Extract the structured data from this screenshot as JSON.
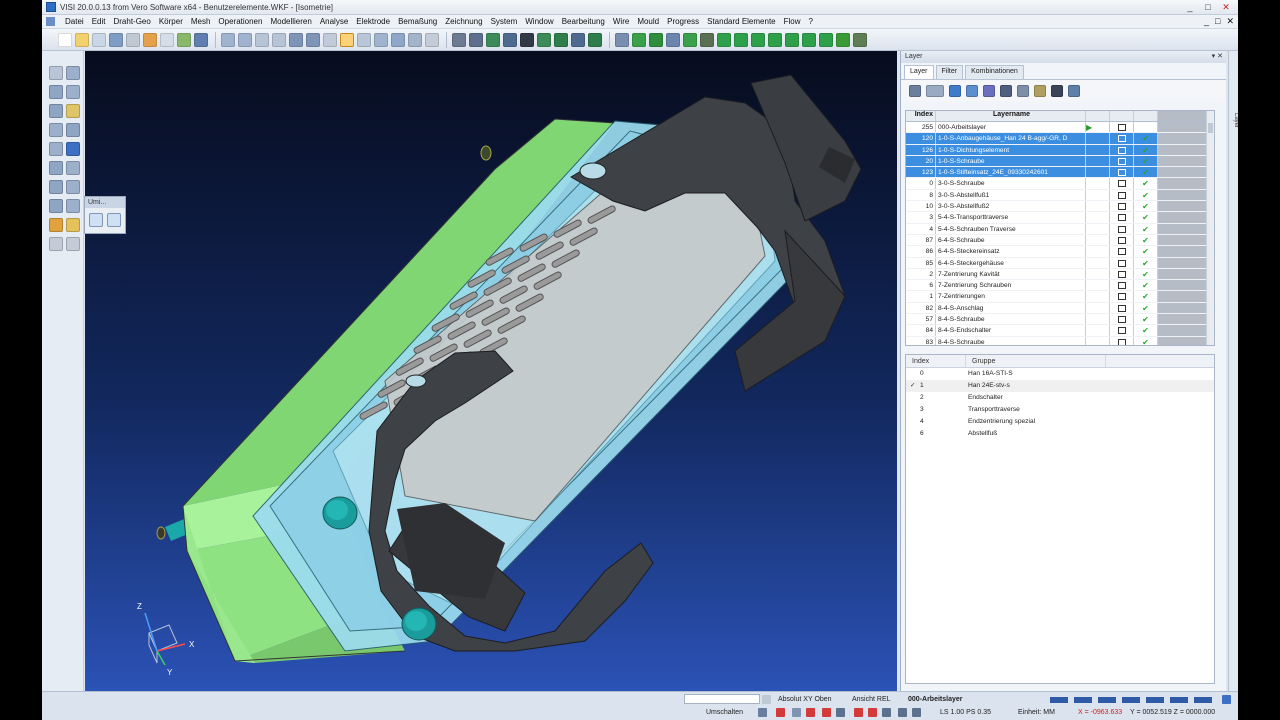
{
  "window": {
    "title": "VISI 20.0.0.13 from Vero Software x64 - Benutzerelemente.WKF - [Isometrie]",
    "minimize": "_",
    "maximize": "□",
    "close": "✕"
  },
  "menu": {
    "items": [
      "Datei",
      "Edit",
      "Draht-Geo",
      "Körper",
      "Mesh",
      "Operationen",
      "Modellieren",
      "Analyse",
      "Elektrode",
      "Bemaßung",
      "Zeichnung",
      "System",
      "Window",
      "Bearbeitung",
      "Wire",
      "Mould",
      "Progress",
      "Standard Elemente",
      "Flow",
      "?"
    ],
    "controls": [
      "_",
      "□",
      "✕"
    ]
  },
  "float_palette": {
    "title": "Umi..."
  },
  "layer_panel": {
    "title": "Layer",
    "pin": "▾ ✕",
    "tabs": [
      "Layer",
      "Filter",
      "Kombinationen"
    ],
    "active_tab": "Layer",
    "columns": {
      "index": "Index",
      "name": "Layername"
    },
    "rows": [
      {
        "index": "255",
        "name": "000-Arbeitslayer",
        "selected": false,
        "active": true,
        "visible": false
      },
      {
        "index": "120",
        "name": "1-0-S-Anbaugehäuse_Han 24 B-agg/-GR, D",
        "selected": true,
        "active": false,
        "visible": true
      },
      {
        "index": "126",
        "name": "1-0-S-Dichtungselement",
        "selected": true,
        "active": false,
        "visible": true
      },
      {
        "index": "20",
        "name": "1-0-S-Schraube",
        "selected": true,
        "active": false,
        "visible": true
      },
      {
        "index": "123",
        "name": "1-0-S-Stifteinsatz_24E_09330242601",
        "selected": true,
        "active": false,
        "visible": true
      },
      {
        "index": "0",
        "name": "3-0-S-Schraube",
        "selected": false,
        "active": false,
        "visible": true
      },
      {
        "index": "8",
        "name": "3-0-S-Abstellfuß1",
        "selected": false,
        "active": false,
        "visible": true
      },
      {
        "index": "10",
        "name": "3-0-S-Abstellfuß2",
        "selected": false,
        "active": false,
        "visible": true
      },
      {
        "index": "3",
        "name": "5-4-S-Transporttraverse",
        "selected": false,
        "active": false,
        "visible": true
      },
      {
        "index": "4",
        "name": "5-4-S-Schrauben Traverse",
        "selected": false,
        "active": false,
        "visible": true
      },
      {
        "index": "87",
        "name": "6-4-S-Schraube",
        "selected": false,
        "active": false,
        "visible": true
      },
      {
        "index": "86",
        "name": "6-4-S-Steckereinsatz",
        "selected": false,
        "active": false,
        "visible": true
      },
      {
        "index": "85",
        "name": "6-4-S-Steckergehäuse",
        "selected": false,
        "active": false,
        "visible": true
      },
      {
        "index": "2",
        "name": "7-Zentrierung Kavität",
        "selected": false,
        "active": false,
        "visible": true
      },
      {
        "index": "6",
        "name": "7-Zentrierung Schrauben",
        "selected": false,
        "active": false,
        "visible": true
      },
      {
        "index": "1",
        "name": "7-Zentrierungen",
        "selected": false,
        "active": false,
        "visible": true
      },
      {
        "index": "82",
        "name": "8-4-S-Anschlag",
        "selected": false,
        "active": false,
        "visible": true
      },
      {
        "index": "57",
        "name": "8-4-S-Schraube",
        "selected": false,
        "active": false,
        "visible": true
      },
      {
        "index": "84",
        "name": "8-4-S-Endschalter",
        "selected": false,
        "active": false,
        "visible": true
      },
      {
        "index": "83",
        "name": "8-4-S-Schraube",
        "selected": false,
        "active": false,
        "visible": true
      }
    ]
  },
  "group_panel": {
    "columns": {
      "index": "Index",
      "name": "Gruppe"
    },
    "rows": [
      {
        "index": "0",
        "name": "Han 16A-STI-S",
        "current": false
      },
      {
        "index": "1",
        "name": "Han 24E-stv-s",
        "current": true
      },
      {
        "index": "2",
        "name": "Endschalter",
        "current": false
      },
      {
        "index": "3",
        "name": "Transporttraverse",
        "current": false
      },
      {
        "index": "4",
        "name": "Endzentrierung spezial",
        "current": false
      },
      {
        "index": "6",
        "name": "Abstellfuß",
        "current": false
      }
    ],
    "current_mark": "✓"
  },
  "side_tab": {
    "label": "Layer"
  },
  "statusbar": {
    "view_mode": "Absolut XY Oben",
    "view_ref": "Ansicht REL",
    "active_layer": "000-Arbeitslayer",
    "toggle_label": "Umschalten",
    "scale_info": "LS 1.00 PS 0.35",
    "unit": "Einheit: MM",
    "coord_x": "X = -0963.633",
    "coord_yz": "Y = 0052.519 Z = 0000.000"
  },
  "axes": {
    "x": "X",
    "y": "Y",
    "z": "Z"
  },
  "colors": {
    "accent": "#3c8fe0",
    "check": "#1faa2b",
    "housing_green": "#9be88e",
    "housing_blue": "#9fdcee",
    "clamp": "#3e4145",
    "pin_teal": "#199c9c"
  }
}
